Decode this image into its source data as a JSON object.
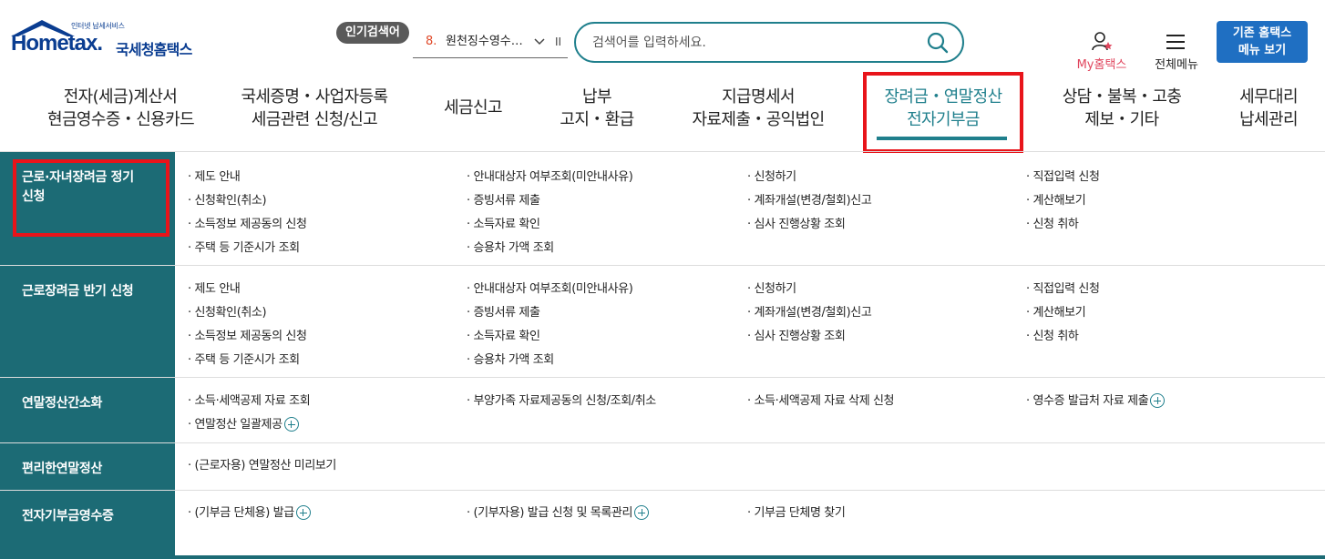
{
  "header": {
    "logo_small": "인터넷 납세서비스",
    "logo_main": "Hometax.",
    "logo_kor": "국세청홈택스",
    "popular_badge": "인기검색어",
    "popular_num": "8.",
    "popular_text": "원천징수영수…",
    "popular_pause": "II",
    "search_placeholder": "검색어를 입력하세요.",
    "my_hometax": "My홈택스",
    "all_menu": "전체메뉴",
    "old_menu_line1": "기존 홈택스",
    "old_menu_line2": "메뉴 보기"
  },
  "gnb": [
    {
      "l1": "전자(세금)계산서",
      "l2": "현금영수증・신용카드"
    },
    {
      "l1": "국세증명・사업자등록",
      "l2": "세금관련 신청/신고"
    },
    {
      "l1": "세금신고",
      "l2": ""
    },
    {
      "l1": "납부",
      "l2": "고지・환급"
    },
    {
      "l1": "지급명세서",
      "l2": "자료제출・공익법인"
    },
    {
      "l1": "장려금・연말정산",
      "l2": "전자기부금"
    },
    {
      "l1": "상담・불복・고충",
      "l2": "제보・기타"
    },
    {
      "l1": "세무대리",
      "l2": "납세관리"
    }
  ],
  "categories": [
    {
      "title_l1": "근로·자녀장려금 정기",
      "title_l2": "신청",
      "links": [
        "· 제도 안내",
        "· 안내대상자 여부조회(미안내사유)",
        "· 신청하기",
        "· 직접입력 신청",
        "· 신청확인(취소)",
        "· 증빙서류 제출",
        "· 계좌개설(변경/철회)신고",
        "· 계산해보기",
        "· 소득정보 제공동의 신청",
        "· 소득자료 확인",
        "· 심사 진행상황 조회",
        "· 신청 취하",
        "· 주택 등 기준시가 조회",
        "· 승용차 가액 조회"
      ]
    },
    {
      "title_l1": "근로장려금 반기 신청",
      "title_l2": "",
      "links": [
        "· 제도 안내",
        "· 안내대상자 여부조회(미안내사유)",
        "· 신청하기",
        "· 직접입력 신청",
        "· 신청확인(취소)",
        "· 증빙서류 제출",
        "· 계좌개설(변경/철회)신고",
        "· 계산해보기",
        "· 소득정보 제공동의 신청",
        "· 소득자료 확인",
        "· 심사 진행상황 조회",
        "· 신청 취하",
        "· 주택 등 기준시가 조회",
        "· 승용차 가액 조회"
      ]
    },
    {
      "title_l1": "연말정산간소화",
      "title_l2": "",
      "links": [
        "· 소득·세액공제 자료 조회",
        "· 부양가족 자료제공동의 신청/조회/취소",
        "· 소득·세액공제 자료 삭제 신청",
        "· 영수증 발급처 자료 제출",
        "· 연말정산 일괄제공"
      ]
    },
    {
      "title_l1": "편리한연말정산",
      "title_l2": "",
      "links": [
        "· (근로자용) 연말정산 미리보기"
      ]
    },
    {
      "title_l1": "전자기부금영수증",
      "title_l2": "",
      "links": [
        "· (기부금 단체용) 발급",
        "· (기부자용) 발급 신청 및 목록관리",
        "· 기부금 단체명 찾기"
      ]
    }
  ]
}
